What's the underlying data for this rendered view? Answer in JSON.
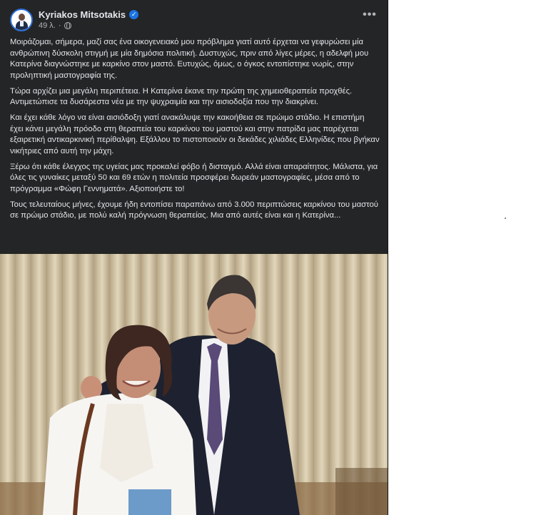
{
  "post": {
    "author": "Kyriakos Mitsotakis",
    "time": "49 λ.",
    "time_separator": "·",
    "verified_icon": "verified-badge-icon",
    "privacy_icon": "globe-icon",
    "more_label": "•••",
    "paragraphs": [
      "Μοιράζομαι, σήμερα, μαζί σας ένα οικογενειακό μου πρόβλημα γιατί αυτό έρχεται να γεφυρώσει μία ανθρώπινη δύσκολη στιγμή με μία δημόσια πολιτική. Δυστυχώς, πριν από λίγες μέρες, η αδελφή μου Κατερίνα διαγνώστηκε με καρκίνο στον μαστό. Ευτυχώς, όμως, ο όγκος εντοπίστηκε νωρίς, στην προληπτική μαστογραφία της.",
      "Τώρα αρχίζει μια μεγάλη περιπέτεια. Η Κατερίνα έκανε την πρώτη της χημειοθεραπεία προχθές. Αντιμετώπισε τα δυσάρεστα νέα με την ψυχραιμία και την αισιοδοξία που την διακρίνει.",
      "Και έχει κάθε λόγο να είναι αισιόδοξη γιατί ανακάλυψε την κακοήθεια σε πρώιμο στάδιο. Η επιστήμη έχει κάνει μεγάλη πρόοδο στη θεραπεία του καρκίνου του μαστού και στην πατρίδα μας παρέχεται εξαιρετική αντικαρκινική περίθαλψη. Εξάλλου το πιστοποιούν οι δεκάδες χιλιάδες Ελληνίδες που βγήκαν νικήτριες από αυτή την μάχη.",
      "Ξέρω ότι κάθε έλεγχος της υγείας μας προκαλεί φόβο ή δισταγμό. Αλλά είναι απαραίτητος. Μάλιστα, για όλες τις γυναίκες μεταξύ 50 και 69 ετών η πολιτεία προσφέρει δωρεάν μαστογραφίες, μέσα από το πρόγραμμα «Φώφη Γεννηματά». Αξιοποιήστε το!",
      "Τους τελευταίους μήνες, έχουμε ήδη εντοπίσει παραπάνω από 3.000 περιπτώσεις καρκίνου του μαστού σε πρώιμο στάδιο, με πολύ καλή πρόγνωση θεραπείας. Μια από αυτές είναι και η Κατερίνα..."
    ]
  },
  "colors": {
    "post_bg": "#242526",
    "text_primary": "#e4e6eb",
    "text_secondary": "#b0b3b8",
    "verified_blue": "#1b74e4"
  }
}
